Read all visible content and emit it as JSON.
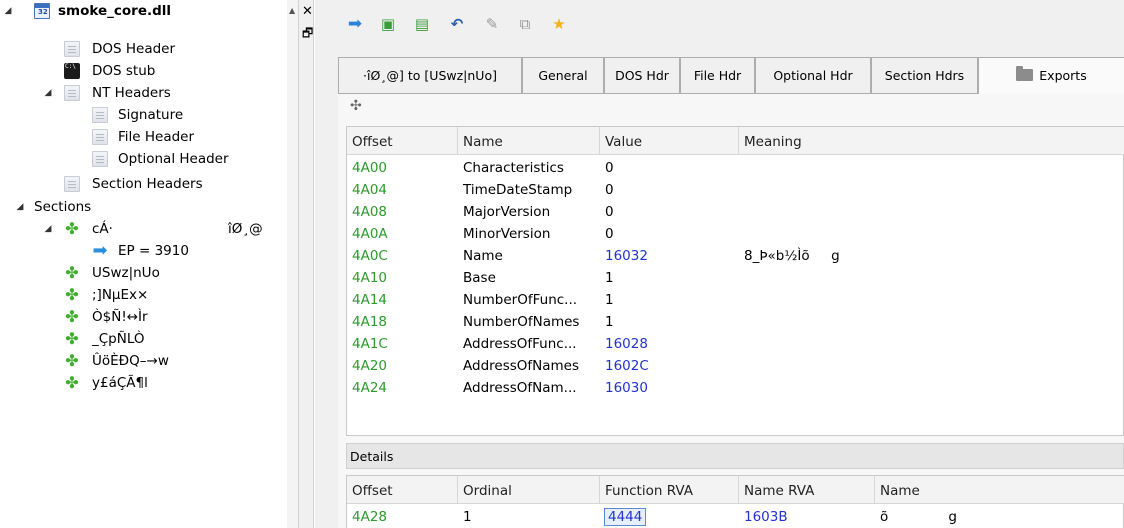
{
  "tree": {
    "root": "smoke_core.dll",
    "dos_header": "DOS Header",
    "dos_stub": "DOS stub",
    "nt_headers": "NT Headers",
    "signature": "Signature",
    "file_header": "File Header",
    "optional_header": "Optional Header",
    "section_headers": "Section Headers",
    "sections": "Sections",
    "section_items": [
      "cÁ·",
      "USwz|nUo",
      ";]NµEx×",
      "Ò$Ñ!↔Ìr",
      "_ÇpÑLÒ",
      "ÛöÈÐQ–→w",
      "y£áÇÃ¶l"
    ],
    "section0_tail": "îØ¸@",
    "ep_label": "EP = 3910"
  },
  "pane": {
    "close_glyph": "✕",
    "restore_glyph": "🗗"
  },
  "toolbar": {
    "icons": [
      "arrow-right-icon",
      "save-icon",
      "save-as-icon",
      "undo-icon",
      "pin-icon",
      "copy-icon",
      "star-icon"
    ]
  },
  "tabs": [
    {
      "label": "·îØ¸@] to [USwz|nUo]"
    },
    {
      "label": "General"
    },
    {
      "label": "DOS Hdr"
    },
    {
      "label": "File Hdr"
    },
    {
      "label": "Optional Hdr"
    },
    {
      "label": "Section Hdrs"
    },
    {
      "label": "Exports"
    }
  ],
  "main_table": {
    "columns": [
      "Offset",
      "Name",
      "Value",
      "Meaning"
    ],
    "rows": [
      {
        "offset": "4A00",
        "name": "Characteristics",
        "value": "0",
        "meaning": ""
      },
      {
        "offset": "4A04",
        "name": "TimeDateStamp",
        "value": "0",
        "meaning": ""
      },
      {
        "offset": "4A08",
        "name": "MajorVersion",
        "value": "0",
        "meaning": ""
      },
      {
        "offset": "4A0A",
        "name": "MinorVersion",
        "value": "0",
        "meaning": ""
      },
      {
        "offset": "4A0C",
        "name": "Name",
        "value": "16032",
        "meaning": "8_Þ«b½Ìõ     g"
      },
      {
        "offset": "4A10",
        "name": "Base",
        "value": "1",
        "meaning": ""
      },
      {
        "offset": "4A14",
        "name": "NumberOfFunc...",
        "value": "1",
        "meaning": ""
      },
      {
        "offset": "4A18",
        "name": "NumberOfNames",
        "value": "1",
        "meaning": ""
      },
      {
        "offset": "4A1C",
        "name": "AddressOfFunc...",
        "value": "16028",
        "meaning": ""
      },
      {
        "offset": "4A20",
        "name": "AddressOfNames",
        "value": "1602C",
        "meaning": ""
      },
      {
        "offset": "4A24",
        "name": "AddressOfNam...",
        "value": "16030",
        "meaning": ""
      }
    ]
  },
  "details": {
    "label": "Details",
    "columns": [
      "Offset",
      "Ordinal",
      "Function RVA",
      "Name RVA",
      "Name"
    ],
    "rows": [
      {
        "offset": "4A28",
        "ordinal": "1",
        "function_rva": "4444",
        "name_rva": "1603B",
        "name": "õ              g"
      }
    ]
  }
}
